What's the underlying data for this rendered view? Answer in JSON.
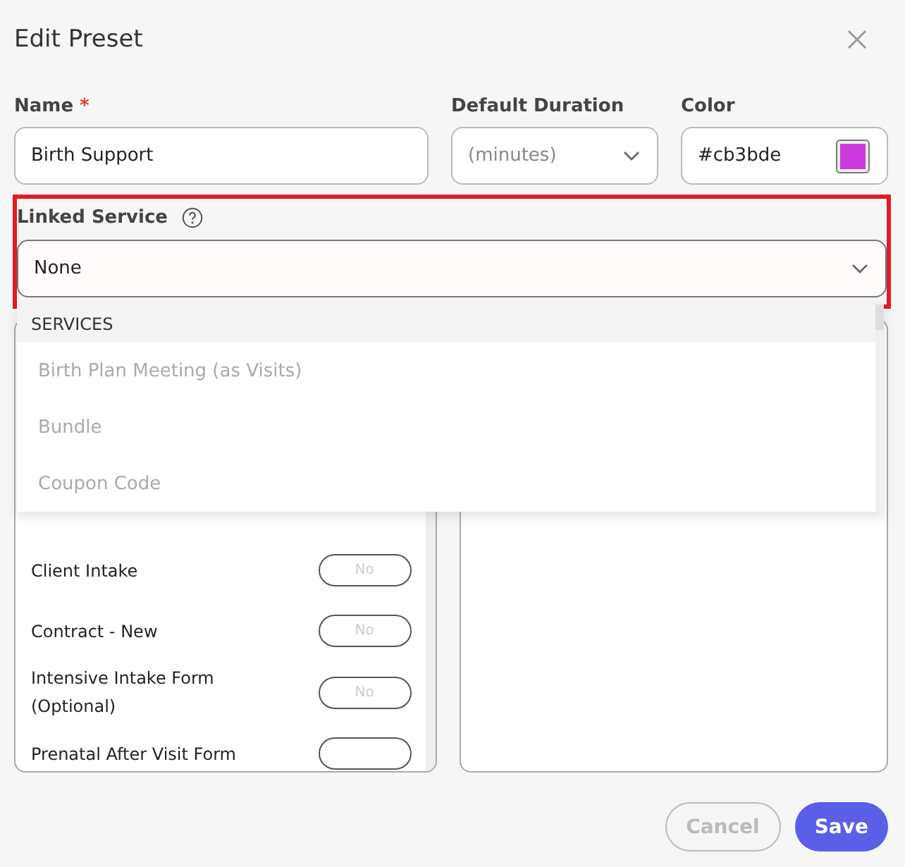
{
  "dialog": {
    "title": "Edit Preset"
  },
  "fields": {
    "name": {
      "label": "Name",
      "required": true,
      "required_mark": "*",
      "value": "Birth Support"
    },
    "duration": {
      "label": "Default Duration",
      "placeholder": "(minutes)"
    },
    "color": {
      "label": "Color",
      "value": "#cb3bde"
    }
  },
  "linked_service": {
    "label": "Linked Service",
    "value": "None",
    "highlighted": true,
    "menu": {
      "group": "SERVICES",
      "options": [
        {
          "label": "Birth Plan Meeting (as Visits)",
          "disabled": true
        },
        {
          "label": "Bundle",
          "disabled": true
        },
        {
          "label": "Coupon Code",
          "disabled": true
        }
      ]
    }
  },
  "forms": [
    {
      "label": "Client Intake",
      "toggle": "No",
      "on": false
    },
    {
      "label": "Contract - New",
      "toggle": "No",
      "on": false
    },
    {
      "label": "Intensive Intake Form (Optional)",
      "toggle": "No",
      "on": false
    },
    {
      "label": "Prenatal After Visit Form",
      "on": false
    }
  ],
  "buttons": [
    {
      "label": "Cancel",
      "kind": "secondary",
      "disabled": true
    },
    {
      "label": "Save",
      "kind": "primary",
      "disabled": false
    }
  ]
}
